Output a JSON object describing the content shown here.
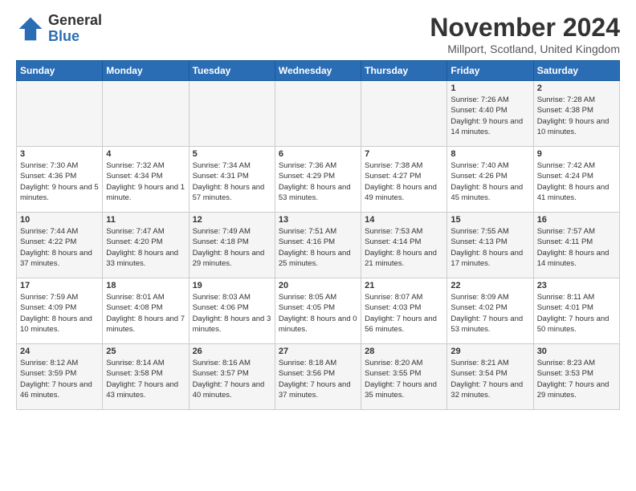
{
  "logo": {
    "general": "General",
    "blue": "Blue"
  },
  "title": "November 2024",
  "location": "Millport, Scotland, United Kingdom",
  "days_of_week": [
    "Sunday",
    "Monday",
    "Tuesday",
    "Wednesday",
    "Thursday",
    "Friday",
    "Saturday"
  ],
  "weeks": [
    [
      {
        "day": "",
        "info": ""
      },
      {
        "day": "",
        "info": ""
      },
      {
        "day": "",
        "info": ""
      },
      {
        "day": "",
        "info": ""
      },
      {
        "day": "",
        "info": ""
      },
      {
        "day": "1",
        "info": "Sunrise: 7:26 AM\nSunset: 4:40 PM\nDaylight: 9 hours and 14 minutes."
      },
      {
        "day": "2",
        "info": "Sunrise: 7:28 AM\nSunset: 4:38 PM\nDaylight: 9 hours and 10 minutes."
      }
    ],
    [
      {
        "day": "3",
        "info": "Sunrise: 7:30 AM\nSunset: 4:36 PM\nDaylight: 9 hours and 5 minutes."
      },
      {
        "day": "4",
        "info": "Sunrise: 7:32 AM\nSunset: 4:34 PM\nDaylight: 9 hours and 1 minute."
      },
      {
        "day": "5",
        "info": "Sunrise: 7:34 AM\nSunset: 4:31 PM\nDaylight: 8 hours and 57 minutes."
      },
      {
        "day": "6",
        "info": "Sunrise: 7:36 AM\nSunset: 4:29 PM\nDaylight: 8 hours and 53 minutes."
      },
      {
        "day": "7",
        "info": "Sunrise: 7:38 AM\nSunset: 4:27 PM\nDaylight: 8 hours and 49 minutes."
      },
      {
        "day": "8",
        "info": "Sunrise: 7:40 AM\nSunset: 4:26 PM\nDaylight: 8 hours and 45 minutes."
      },
      {
        "day": "9",
        "info": "Sunrise: 7:42 AM\nSunset: 4:24 PM\nDaylight: 8 hours and 41 minutes."
      }
    ],
    [
      {
        "day": "10",
        "info": "Sunrise: 7:44 AM\nSunset: 4:22 PM\nDaylight: 8 hours and 37 minutes."
      },
      {
        "day": "11",
        "info": "Sunrise: 7:47 AM\nSunset: 4:20 PM\nDaylight: 8 hours and 33 minutes."
      },
      {
        "day": "12",
        "info": "Sunrise: 7:49 AM\nSunset: 4:18 PM\nDaylight: 8 hours and 29 minutes."
      },
      {
        "day": "13",
        "info": "Sunrise: 7:51 AM\nSunset: 4:16 PM\nDaylight: 8 hours and 25 minutes."
      },
      {
        "day": "14",
        "info": "Sunrise: 7:53 AM\nSunset: 4:14 PM\nDaylight: 8 hours and 21 minutes."
      },
      {
        "day": "15",
        "info": "Sunrise: 7:55 AM\nSunset: 4:13 PM\nDaylight: 8 hours and 17 minutes."
      },
      {
        "day": "16",
        "info": "Sunrise: 7:57 AM\nSunset: 4:11 PM\nDaylight: 8 hours and 14 minutes."
      }
    ],
    [
      {
        "day": "17",
        "info": "Sunrise: 7:59 AM\nSunset: 4:09 PM\nDaylight: 8 hours and 10 minutes."
      },
      {
        "day": "18",
        "info": "Sunrise: 8:01 AM\nSunset: 4:08 PM\nDaylight: 8 hours and 7 minutes."
      },
      {
        "day": "19",
        "info": "Sunrise: 8:03 AM\nSunset: 4:06 PM\nDaylight: 8 hours and 3 minutes."
      },
      {
        "day": "20",
        "info": "Sunrise: 8:05 AM\nSunset: 4:05 PM\nDaylight: 8 hours and 0 minutes."
      },
      {
        "day": "21",
        "info": "Sunrise: 8:07 AM\nSunset: 4:03 PM\nDaylight: 7 hours and 56 minutes."
      },
      {
        "day": "22",
        "info": "Sunrise: 8:09 AM\nSunset: 4:02 PM\nDaylight: 7 hours and 53 minutes."
      },
      {
        "day": "23",
        "info": "Sunrise: 8:11 AM\nSunset: 4:01 PM\nDaylight: 7 hours and 50 minutes."
      }
    ],
    [
      {
        "day": "24",
        "info": "Sunrise: 8:12 AM\nSunset: 3:59 PM\nDaylight: 7 hours and 46 minutes."
      },
      {
        "day": "25",
        "info": "Sunrise: 8:14 AM\nSunset: 3:58 PM\nDaylight: 7 hours and 43 minutes."
      },
      {
        "day": "26",
        "info": "Sunrise: 8:16 AM\nSunset: 3:57 PM\nDaylight: 7 hours and 40 minutes."
      },
      {
        "day": "27",
        "info": "Sunrise: 8:18 AM\nSunset: 3:56 PM\nDaylight: 7 hours and 37 minutes."
      },
      {
        "day": "28",
        "info": "Sunrise: 8:20 AM\nSunset: 3:55 PM\nDaylight: 7 hours and 35 minutes."
      },
      {
        "day": "29",
        "info": "Sunrise: 8:21 AM\nSunset: 3:54 PM\nDaylight: 7 hours and 32 minutes."
      },
      {
        "day": "30",
        "info": "Sunrise: 8:23 AM\nSunset: 3:53 PM\nDaylight: 7 hours and 29 minutes."
      }
    ]
  ]
}
